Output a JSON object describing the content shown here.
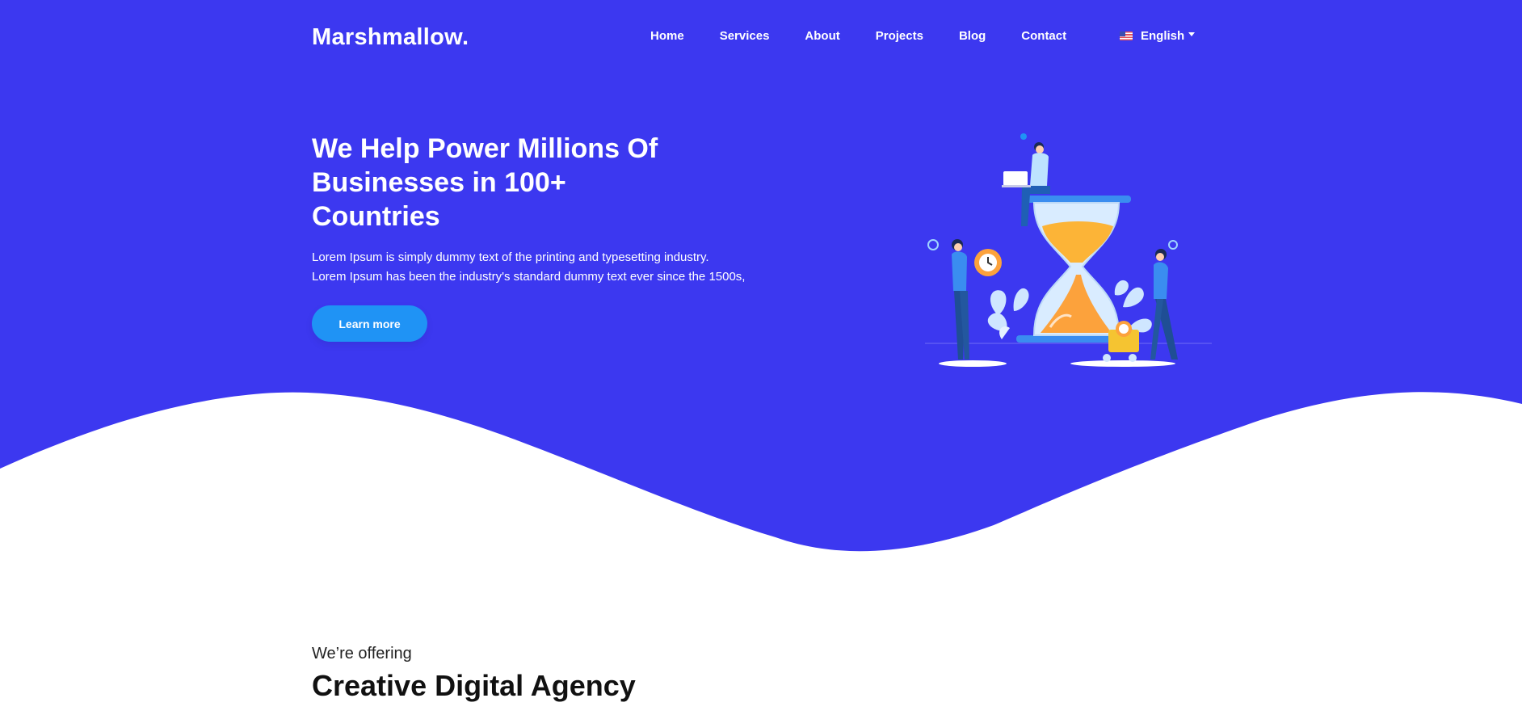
{
  "brand": {
    "logo": "Marshmallow."
  },
  "nav": {
    "items": [
      "Home",
      "Services",
      "About",
      "Projects",
      "Blog",
      "Contact"
    ],
    "language": "English",
    "language_icon": "us-flag-icon"
  },
  "hero": {
    "headline": "We Help Power Millions Of Businesses in 100+ Countries",
    "desc_line1": "Lorem Ipsum is simply dummy text of the printing and typesetting industry.",
    "desc_line2": "Lorem Ipsum has been the industry's standard dummy text ever since the 1500s,",
    "cta": "Learn more",
    "illustration": "hourglass-team-illustration"
  },
  "section": {
    "kicker": "We’re offering",
    "title": "Creative Digital Agency"
  },
  "colors": {
    "primary": "#3c38f0",
    "button": "#1f93f5",
    "text_light": "#ffffff",
    "text_dark": "#111111"
  }
}
